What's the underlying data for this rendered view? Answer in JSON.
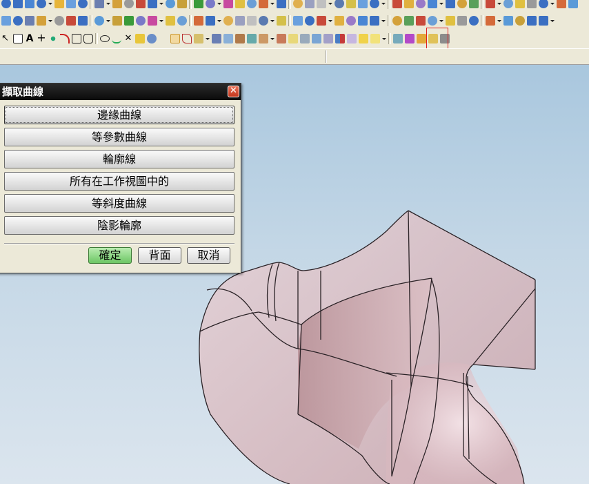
{
  "dialog": {
    "title": "擷取曲線",
    "options": [
      {
        "label": "邊緣曲線",
        "selected": true
      },
      {
        "label": "等參數曲線"
      },
      {
        "label": "輪廓線"
      },
      {
        "label": "所有在工作視圖中的"
      },
      {
        "label": "等斜度曲線"
      },
      {
        "label": "陰影輪廓"
      }
    ],
    "ok_label": "確定",
    "back_label": "背面",
    "cancel_label": "取消",
    "close_glyph": "✕"
  },
  "toolbar": {
    "highlighted_tool_icon": "extract-curve-icon",
    "highlight_color": "#e02020",
    "row3_glyphs": {
      "text_tool": "A",
      "plus_tool": "+",
      "delete_tool": "✕"
    }
  },
  "colors": {
    "viewport_top": "#a9c7de",
    "viewport_bottom": "#dbe5ee",
    "model_face": "#d8b7bd",
    "model_edge": "#2a2226",
    "ok_button": "#6cc664"
  }
}
